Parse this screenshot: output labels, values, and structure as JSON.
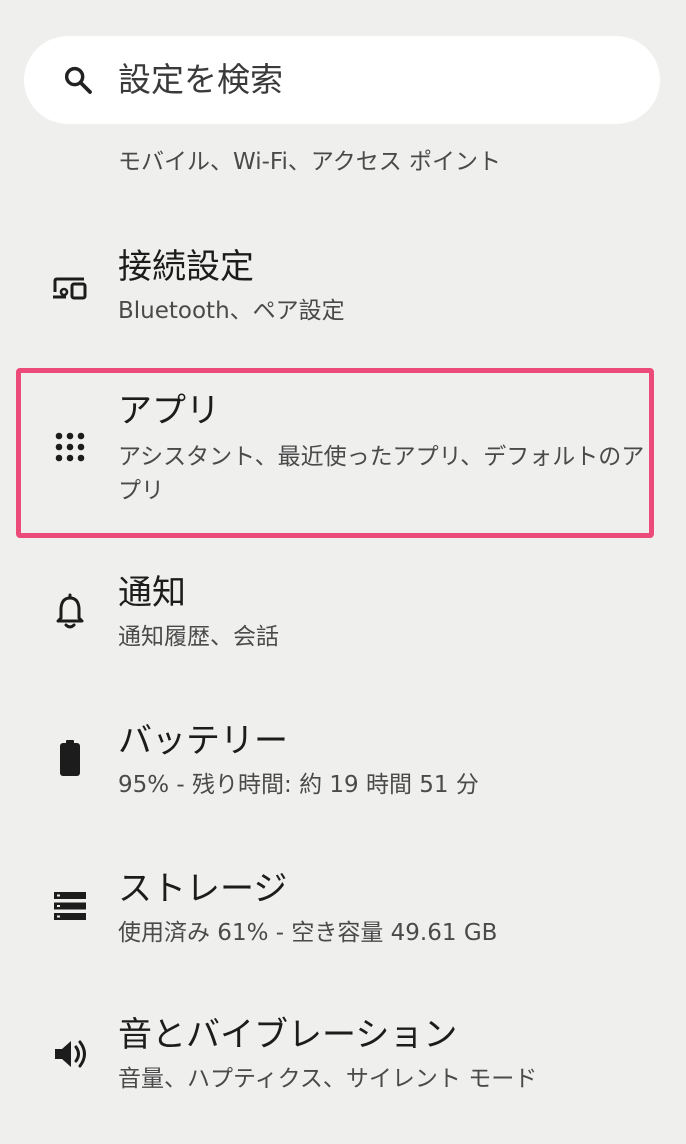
{
  "search": {
    "placeholder": "設定を検索"
  },
  "partial_item": {
    "subtitle": "モバイル、Wi-Fi、アクセス ポイント"
  },
  "items": [
    {
      "title": "接続設定",
      "subtitle": "Bluetooth、ペア設定",
      "icon": "connected-devices-icon"
    },
    {
      "title": "アプリ",
      "subtitle": "アシスタント、最近使ったアプリ、デフォルトのアプリ",
      "icon": "apps-grid-icon"
    },
    {
      "title": "通知",
      "subtitle": "通知履歴、会話",
      "icon": "bell-icon"
    },
    {
      "title": "バッテリー",
      "subtitle": "95% - 残り時間: 約 19 時間 51 分",
      "icon": "battery-icon"
    },
    {
      "title": "ストレージ",
      "subtitle": "使用済み 61% - 空き容量 49.61 GB",
      "icon": "storage-icon"
    },
    {
      "title": "音とバイブレーション",
      "subtitle": "音量、ハプティクス、サイレント モード",
      "icon": "volume-icon"
    }
  ],
  "colors": {
    "background": "#efefed",
    "highlight": "#ec4a79"
  }
}
